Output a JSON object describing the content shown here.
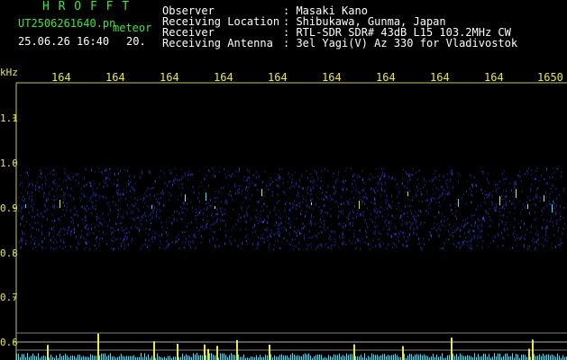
{
  "header": {
    "brand": "H R O F F T",
    "filename": "UT2506261640.pn",
    "kind": "meteor",
    "datetime": "25.06.26 16:40",
    "interval": "20."
  },
  "info": {
    "rows": [
      {
        "label": "Observer",
        "value": ": Masaki Kano"
      },
      {
        "label": "Receiving Location",
        "value": ": Shibukawa, Gunma, Japan"
      },
      {
        "label": "Receiver",
        "value": ": RTL-SDR SDR# 43dB L15 103.2MHz CW"
      },
      {
        "label": "Receiving Antenna",
        "value": ": 3el Yagi(V) Az 330 for Vladivostok"
      }
    ]
  },
  "axes": {
    "y_unit": "kHz",
    "y_ticks": [
      "1.1",
      "1.0",
      "0.9",
      "0.8",
      "0.7",
      "0.6"
    ],
    "x_ticks": [
      "164",
      "164",
      "164",
      "164",
      "164",
      "164",
      "164",
      "164",
      "164",
      "1650"
    ]
  },
  "colors": {
    "background": "#000000",
    "label_yellow": "#e8e84a",
    "label_green": "#3ce63c",
    "noise_blue": "#1a2a9a",
    "signal_cyan": "#40e0ff"
  }
}
